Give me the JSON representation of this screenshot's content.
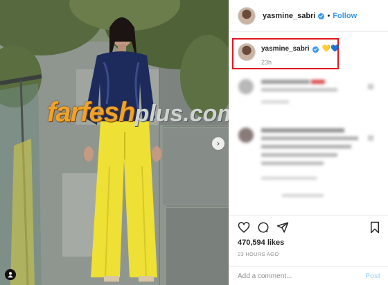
{
  "header": {
    "username": "yasmine_sabri",
    "separator": "•",
    "follow_label": "Follow",
    "verified_icon": "verified-badge-icon"
  },
  "caption": {
    "username": "yasmine_sabri",
    "text": "💛💙",
    "time": "23h"
  },
  "photo": {
    "watermark_main": "farfesh",
    "watermark_plus": "plus.com",
    "next_icon": "chevron-right-icon",
    "tag_icon": "user-tag-icon"
  },
  "actions": {
    "likes": "470,594 likes",
    "time_ago": "23 HOURS AGO",
    "comment_placeholder": "Add a comment...",
    "post_label": "Post"
  },
  "colors": {
    "accent": "#3897f0",
    "highlight_box": "#e0151f",
    "watermark": "#f0a32b"
  }
}
